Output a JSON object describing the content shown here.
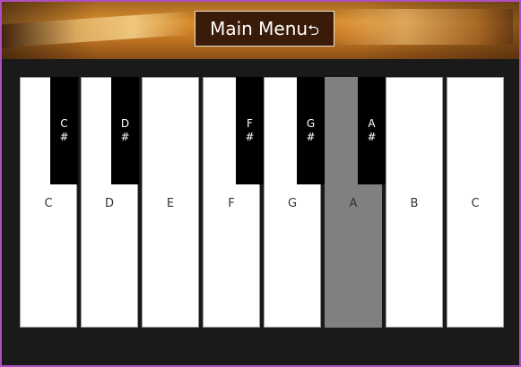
{
  "header": {
    "main_menu_label": "Main Menu",
    "main_menu_icon": "return-arrow-icon",
    "main_menu_glyph": "⮌"
  },
  "keyboard": {
    "white_keys": [
      "C",
      "D",
      "E",
      "F",
      "G",
      "A",
      "B",
      "C"
    ],
    "black_keys": [
      {
        "note": "C",
        "accidental": "#"
      },
      {
        "note": "D",
        "accidental": "#"
      },
      {
        "note": "F",
        "accidental": "#"
      },
      {
        "note": "G",
        "accidental": "#"
      },
      {
        "note": "A",
        "accidental": "#"
      }
    ],
    "active_key": "A"
  },
  "colors": {
    "white_key": "#ffffff",
    "black_key": "#000000",
    "active_key": "#808080",
    "background": "#1a1a1a",
    "frame": "#b04fbf"
  }
}
